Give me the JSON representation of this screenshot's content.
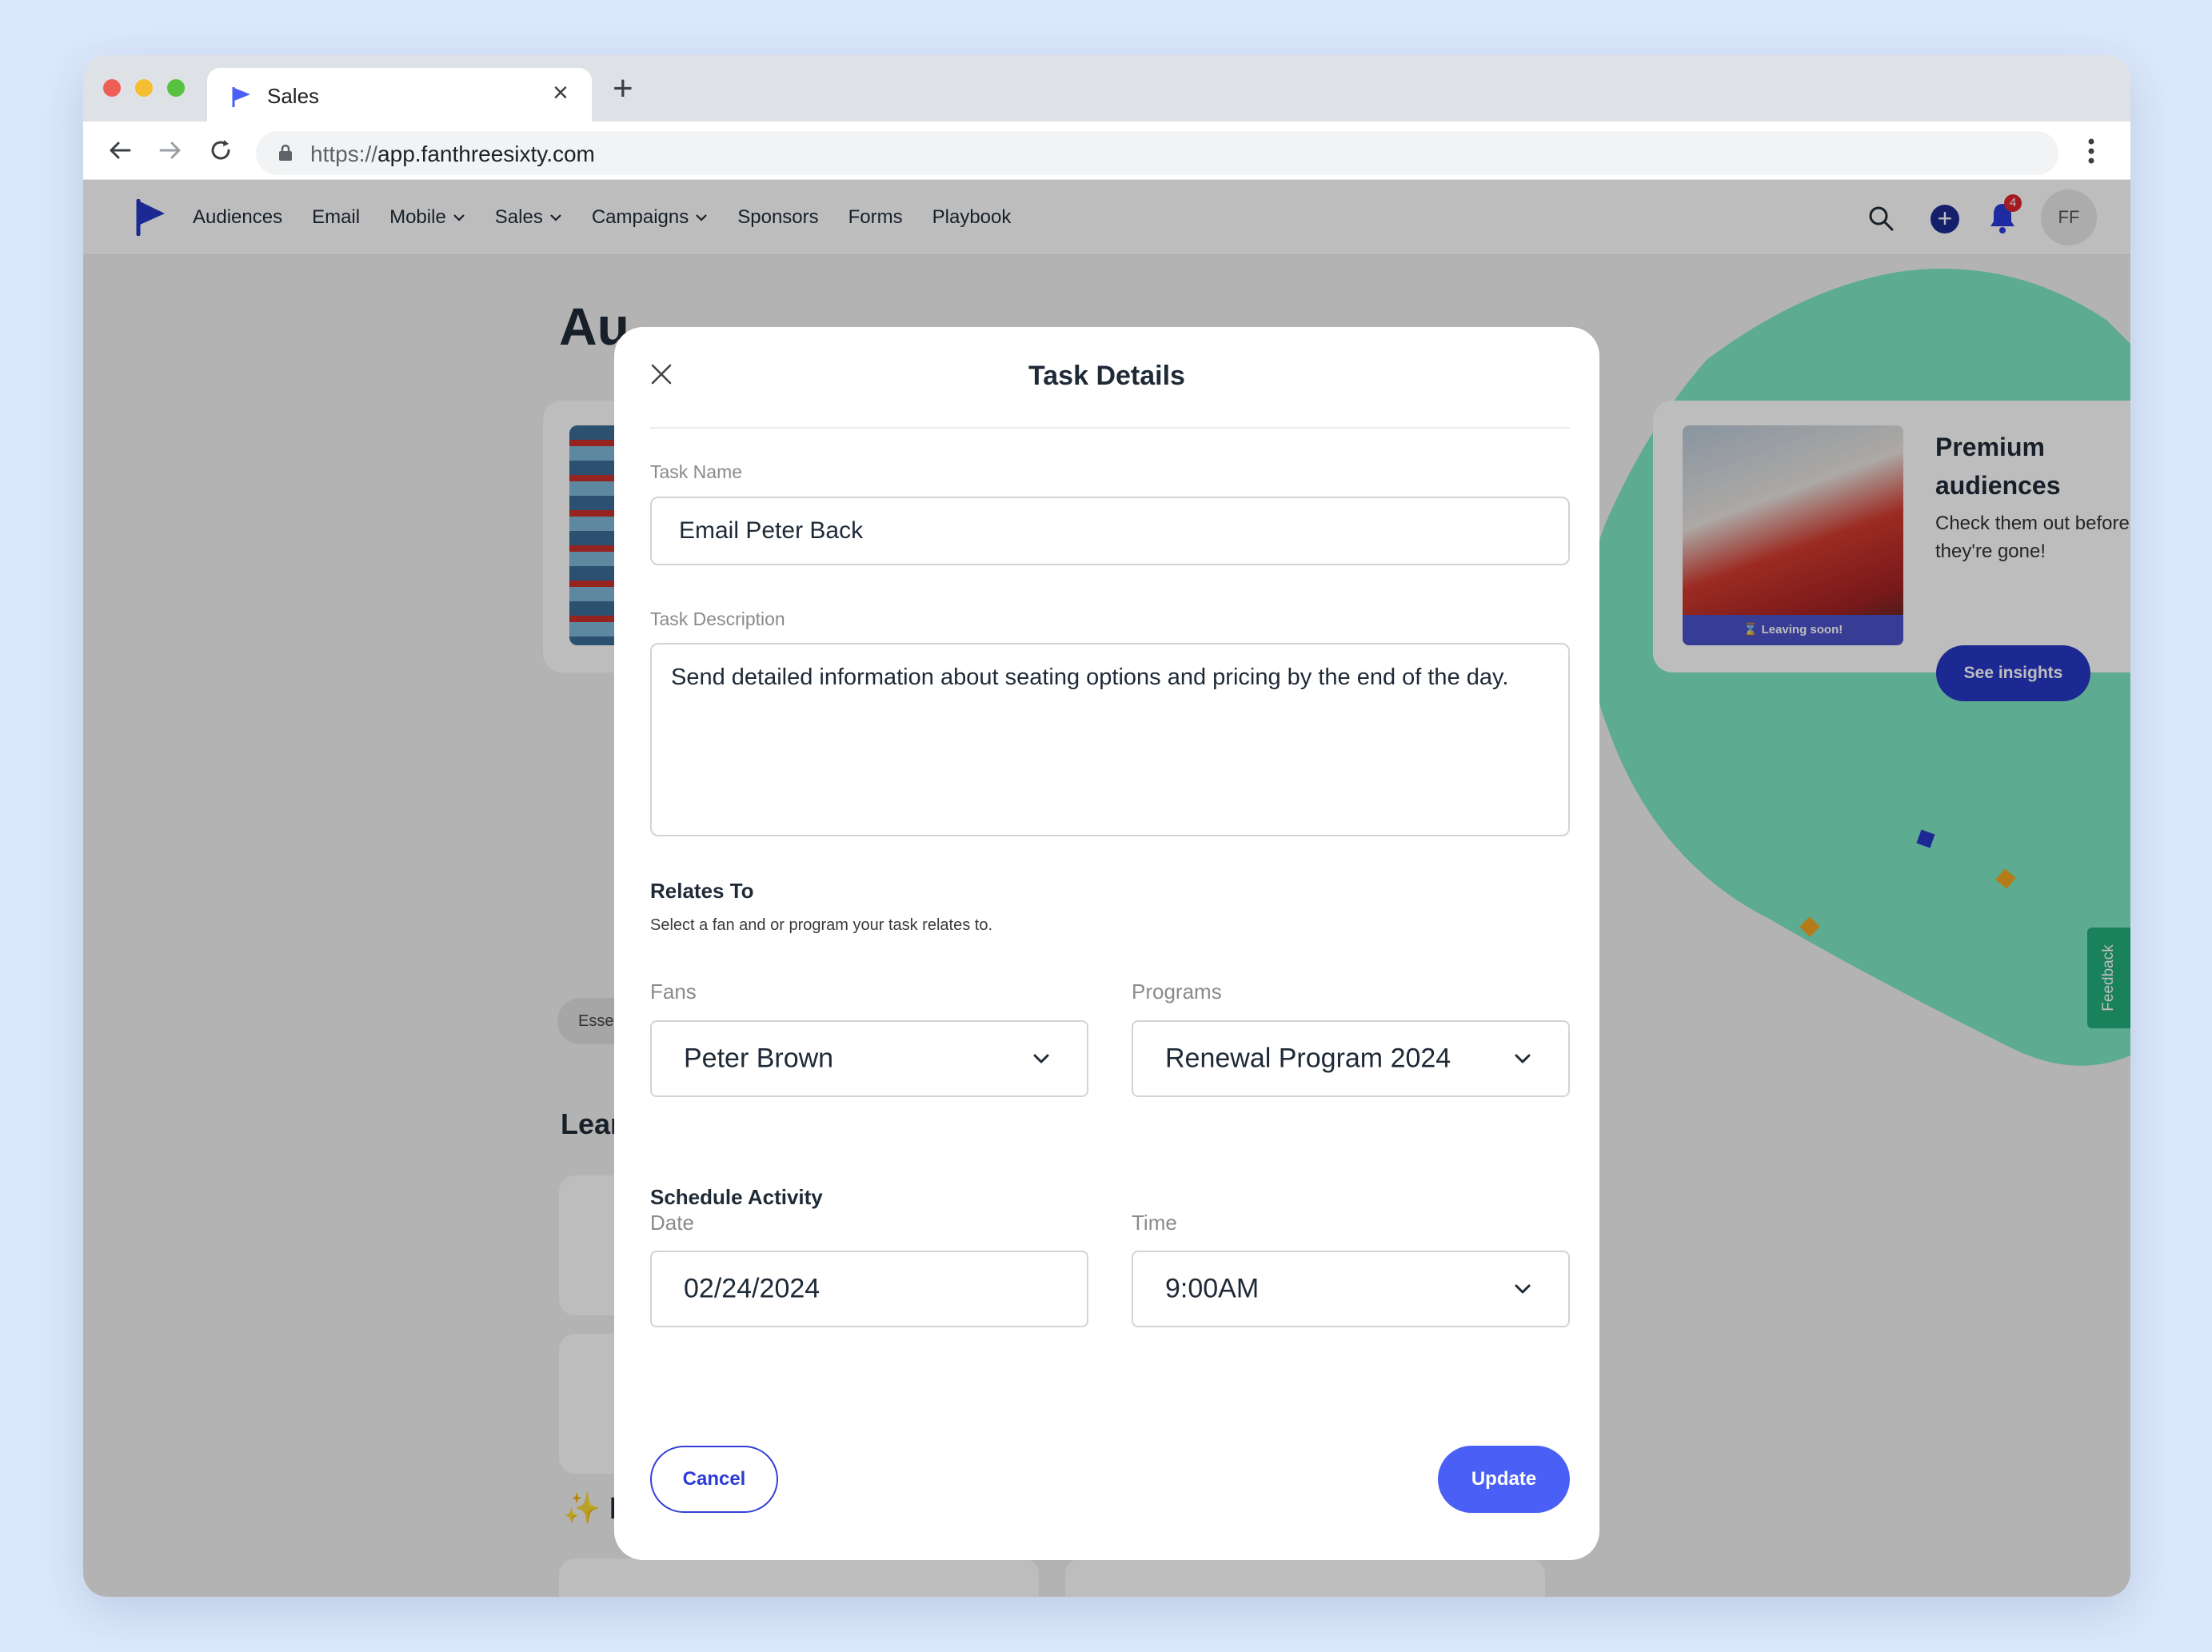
{
  "browser": {
    "tab_title": "Sales",
    "url_scheme": "https://",
    "url_host": "app.fanthreesixty.com"
  },
  "app_nav": {
    "items": [
      {
        "label": "Audiences"
      },
      {
        "label": "Email"
      },
      {
        "label": "Mobile",
        "dropdown": true
      },
      {
        "label": "Sales",
        "dropdown": true
      },
      {
        "label": "Campaigns",
        "dropdown": true
      },
      {
        "label": "Sponsors"
      },
      {
        "label": "Forms"
      },
      {
        "label": "Playbook"
      }
    ],
    "notification_count": "4",
    "avatar_initials": "FF"
  },
  "background": {
    "page_title_partial": "Au",
    "promo": {
      "title": "Premium audiences",
      "subtitle": "Check them out before they're gone!",
      "button": "See insights",
      "image_badge": "⌛ Leaving soon!"
    },
    "chip_partial": "Esse",
    "learn_partial": "Lear",
    "featured_title": "✨ Featured",
    "feedback_tab": "Feedback"
  },
  "modal": {
    "title": "Task Details",
    "task_name_label": "Task Name",
    "task_name_value": "Email Peter Back",
    "task_description_label": "Task Description",
    "task_description_value": "Send detailed information about seating options and pricing by the end of the day.",
    "relates_to_title": "Relates To",
    "relates_to_subtitle": "Select a fan and or program your task relates to.",
    "fans_label": "Fans",
    "fans_value": "Peter Brown",
    "programs_label": "Programs",
    "programs_value": "Renewal Program 2024",
    "schedule_title": "Schedule Activity",
    "date_label": "Date",
    "date_value": "02/24/2024",
    "time_label": "Time",
    "time_value": "9:00AM",
    "cancel_label": "Cancel",
    "update_label": "Update"
  },
  "colors": {
    "accent": "#4a5ff5",
    "brand_navy": "#2838c7",
    "wave_green": "#7ee7c4"
  }
}
